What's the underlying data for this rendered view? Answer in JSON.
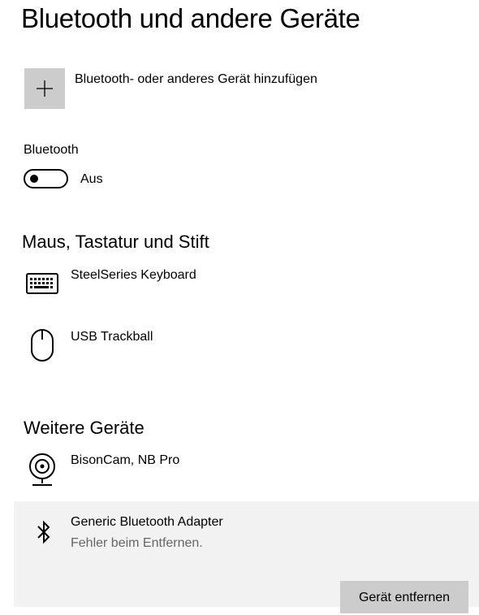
{
  "page": {
    "title": "Bluetooth und andere Geräte"
  },
  "add_device": {
    "label": "Bluetooth- oder anderes Gerät hinzufügen",
    "icon": "plus-icon"
  },
  "bluetooth": {
    "label": "Bluetooth",
    "toggle_state": "Aus",
    "enabled": false
  },
  "sections": {
    "input": {
      "title": "Maus, Tastatur und Stift",
      "devices": [
        {
          "name": "SteelSeries Keyboard",
          "icon": "keyboard-icon"
        },
        {
          "name": "USB Trackball",
          "icon": "mouse-icon"
        }
      ]
    },
    "other": {
      "title": "Weitere Geräte",
      "devices": [
        {
          "name": "BisonCam, NB Pro",
          "icon": "webcam-icon"
        },
        {
          "name": "Generic Bluetooth Adapter",
          "status": "Fehler beim Entfernen.",
          "icon": "bluetooth-icon",
          "selected": true
        }
      ],
      "remove_button": "Gerät entfernen"
    }
  },
  "colors": {
    "button_bg": "#cccccc",
    "selected_bg": "#f2f2f2",
    "status_text": "#666666"
  }
}
